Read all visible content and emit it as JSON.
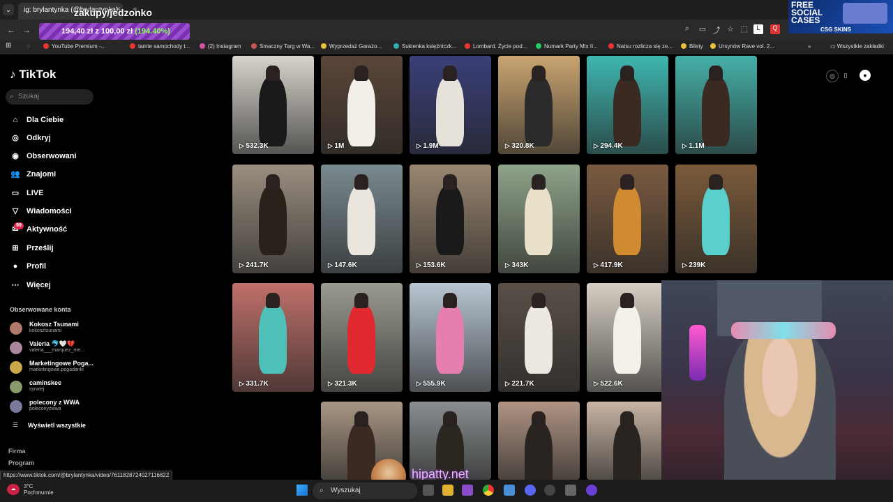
{
  "browser": {
    "tab_title": "ig: brylantynka (@brylantynka)",
    "overlay_title": "zakupy/jedzonko",
    "goal": {
      "amount": "194,40 zł",
      "of": "z 100,00 zł",
      "percent": "(194.40%)"
    },
    "bookmarks": [
      "YouTube Premium -...",
      "tamte samochody t...",
      "(2) Instagram",
      "Smaczny Targ w Wa...",
      "Wyprzedaż Garażo...",
      "Sukienka księżniczk...",
      "Lombard. Życie pod...",
      "Numark Party Mix II...",
      "Natsu rozlicza się ze...",
      "Bilety",
      "Ursynów Rave vol. 2..."
    ],
    "bookmarks_all": "Wszystkie zakładki"
  },
  "ad": {
    "line1": "FREE",
    "line2": "SOCIAL",
    "line3": "CASES",
    "brand": "CSG SKINS"
  },
  "sidebar": {
    "logo": "TikTok",
    "search_placeholder": "Szukaj",
    "nav": [
      "Dla Ciebie",
      "Odkryj",
      "Obserwowani",
      "Znajomi",
      "LIVE",
      "Wiadomości",
      "Aktywność",
      "Prześlij",
      "Profil",
      "Więcej"
    ],
    "activity_badge": "99",
    "followed_title": "Obserwowane konta",
    "accounts": [
      {
        "name": "Kokosz Tsunami",
        "handle": "kokosztsunami",
        "color": "#b07a6a"
      },
      {
        "name": "Valeria 🐬🤍💔",
        "handle": "valeria___marquez_me...",
        "color": "#a8889a"
      },
      {
        "name": "Marketingowe Poga...",
        "handle": "marketingowe.pogadanki",
        "color": "#c9a84a"
      },
      {
        "name": "caminskee",
        "handle": "syrwiej",
        "color": "#8a9a6a"
      },
      {
        "name": "polecony z WWA",
        "handle": "poleconyzwwa",
        "color": "#7a7a9a"
      }
    ],
    "show_all": "Wyświetl wszystkie",
    "footer": [
      "Firma",
      "Program"
    ]
  },
  "status_url": "https://www.tiktok.com/@brylantynka/video/7611828724027116822",
  "videos": [
    {
      "views": "532.3K",
      "bg": "#d8d4cc",
      "fig": "#1a1a1a"
    },
    {
      "views": "1M",
      "bg": "#5a4638",
      "fig": "#f2efe8"
    },
    {
      "views": "1.9M",
      "bg": "#3a3f78",
      "fig": "#e6e2da"
    },
    {
      "views": "320.8K",
      "bg": "#c9a470",
      "fig": "#2a2a2a"
    },
    {
      "views": "294.4K",
      "bg": "#3fb6b0",
      "fig": "#3a2a22"
    },
    {
      "views": "1.1M",
      "bg": "#45b0a8",
      "fig": "#3a2a22"
    },
    {
      "views": "241.7K",
      "bg": "#9a8e80",
      "fig": "#2a201a"
    },
    {
      "views": "147.6K",
      "bg": "#7a8a90",
      "fig": "#eae6de"
    },
    {
      "views": "153.6K",
      "bg": "#9a8670",
      "fig": "#1a1a1a"
    },
    {
      "views": "343K",
      "bg": "#8fa38a",
      "fig": "#e8e0c8"
    },
    {
      "views": "417.9K",
      "bg": "#7a5a40",
      "fig": "#d08a30"
    },
    {
      "views": "239K",
      "bg": "#7a5a3a",
      "fig": "#59d0cc"
    },
    {
      "views": "331.7K",
      "bg": "#c0706a",
      "fig": "#4fc0b8"
    },
    {
      "views": "321.3K",
      "bg": "#9a9a90",
      "fig": "#e02a30"
    },
    {
      "views": "555.9K",
      "bg": "#b8c6d2",
      "fig": "#e67fb0"
    },
    {
      "views": "221.7K",
      "bg": "#5a5048",
      "fig": "#ece8e0"
    },
    {
      "views": "522.6K",
      "bg": "#d6cfc4",
      "fig": "#f4f0ea"
    },
    {
      "views": "",
      "bg": "#c8c2ba",
      "fig": "#2a2420"
    },
    {
      "views": "",
      "bg": "#a89684",
      "fig": "#3a2a22"
    },
    {
      "views": "",
      "bg": "#8a8e90",
      "fig": "#2a2620"
    },
    {
      "views": "",
      "bg": "#b09484",
      "fig": "#2a2420"
    },
    {
      "views": "",
      "bg": "#c8b4a4",
      "fig": "#2a2420"
    }
  ],
  "overlay": {
    "hipatty": "hipatty.net"
  },
  "taskbar": {
    "temp": "3°C",
    "weather": "Pochmurnie",
    "search": "Wyszukaj"
  }
}
